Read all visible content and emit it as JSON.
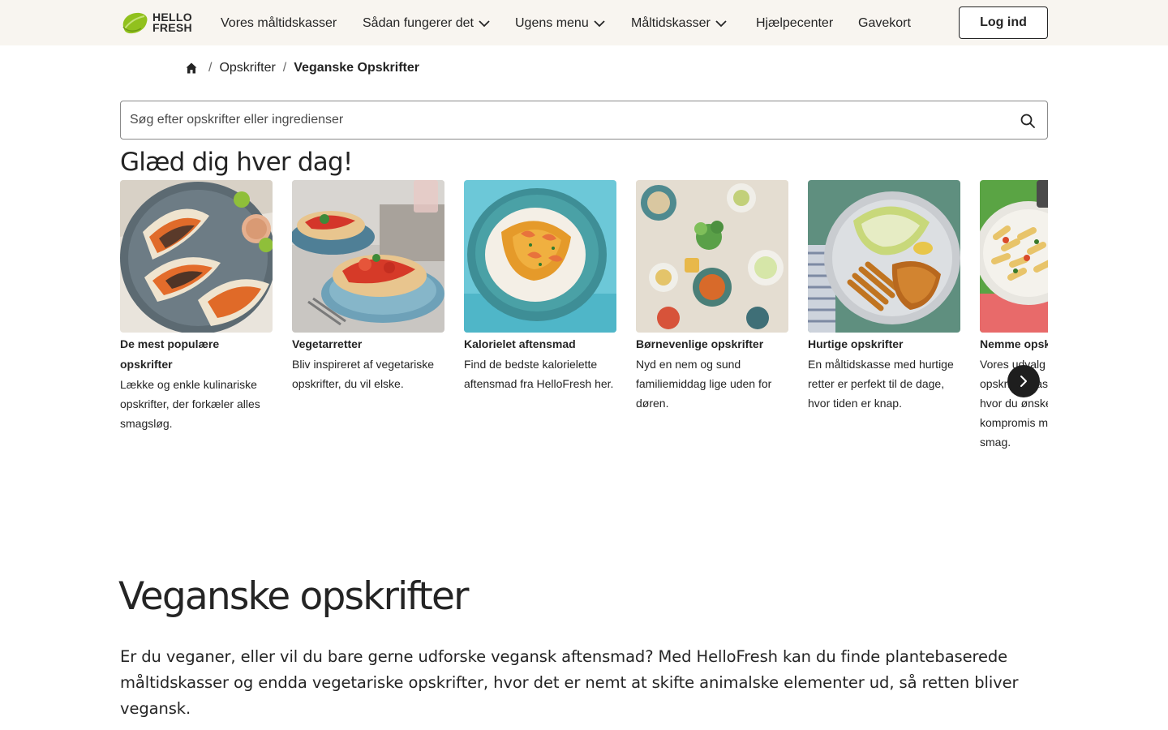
{
  "header": {
    "logo": {
      "line1": "HELLO",
      "line2": "FRESH"
    },
    "nav": [
      {
        "label": "Vores måltidskasser",
        "dropdown": false
      },
      {
        "label": "Sådan fungerer det",
        "dropdown": true
      },
      {
        "label": "Ugens menu",
        "dropdown": true
      },
      {
        "label": "Måltidskasser",
        "dropdown": true
      },
      {
        "label": "Hjælpecenter",
        "dropdown": false
      },
      {
        "label": "Gavekort",
        "dropdown": false
      }
    ],
    "login_label": "Log ind"
  },
  "breadcrumb": {
    "home_icon": "home-icon",
    "items": [
      "Opskrifter",
      "Veganske Opskrifter"
    ],
    "separator": "/"
  },
  "search": {
    "placeholder": "Søg efter opskrifter eller ingredienser",
    "value": "",
    "icon": "search-icon"
  },
  "carousel": {
    "title": "Glæd dig hver dag!",
    "cards": [
      {
        "title": "De mest populære opskrifter",
        "description": "Lække og enkle kulinariske opskrifter, der forkæler alles smagsløg.",
        "image": "tacos"
      },
      {
        "title": "Vegetarretter",
        "description": "Bliv inspireret af vegetariske opskrifter, du vil elske.",
        "image": "flatbread"
      },
      {
        "title": "Kalorielet aftensmad",
        "description": "Find de bedste kalorielette aftensmad fra HelloFresh her.",
        "image": "shrimp-rice"
      },
      {
        "title": "Børnevenlige opskrifter",
        "description": "Nyd en nem og sund familiemiddag lige uden for døren.",
        "image": "family-table"
      },
      {
        "title": "Hurtige opskrifter",
        "description": "En måltidskasse med hurtige retter er perfekt til de dage, hvor tiden er knap.",
        "image": "schnitzel"
      },
      {
        "title": "Nemme opskrifter",
        "description": "Vores udvalg af nemme opskrifter passer til hverdage, hvor du ønsker at gå på kompromis med den gode smag.",
        "image": "pasta"
      }
    ],
    "next_icon": "chevron-right-icon"
  },
  "intro": {
    "title": "Veganske opskrifter",
    "text": "Er du veganer, eller vil du bare gerne udforske vegansk aftensmad? Med HelloFresh kan du finde plantebaserede måltidskasser og endda vegetariske opskrifter, hvor det er nemt at skifte animalske elementer ud, så retten bliver vegansk."
  },
  "colors": {
    "header_bg": "#f8f5f0",
    "brand_green": "#91c11e",
    "text": "#242424",
    "next_button": "#1e1e1e"
  }
}
